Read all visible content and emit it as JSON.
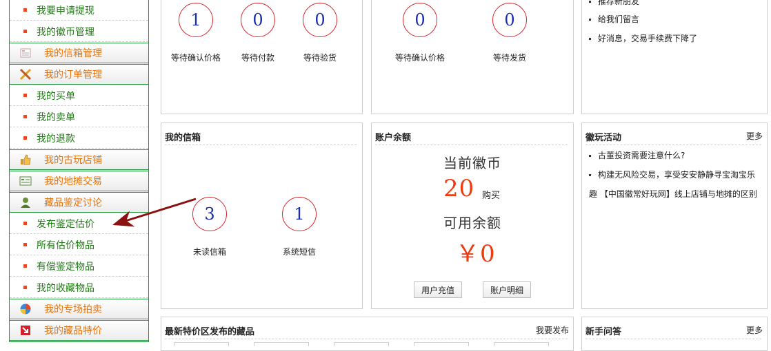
{
  "sidebar": {
    "items": [
      {
        "type": "item",
        "label": "我要申请提现"
      },
      {
        "type": "item",
        "label": "我的徽币管理"
      },
      {
        "type": "header",
        "label": "我的信箱管理",
        "icon": "mailbox-icon"
      },
      {
        "type": "header",
        "label": "我的订单管理",
        "icon": "pencil-ruler-icon"
      },
      {
        "type": "item",
        "label": "我的买单"
      },
      {
        "type": "item",
        "label": "我的卖单"
      },
      {
        "type": "item",
        "label": "我的退款"
      },
      {
        "type": "header",
        "label": "我的古玩店铺",
        "icon": "thumbs-up-icon"
      },
      {
        "type": "header",
        "label": "我的地摊交易",
        "icon": "list-card-icon"
      },
      {
        "type": "header",
        "label": "藏品鉴定讨论",
        "icon": "user-icon"
      },
      {
        "type": "item",
        "label": "发布鉴定估价"
      },
      {
        "type": "item",
        "label": "所有估价物品"
      },
      {
        "type": "item",
        "label": "有偿鉴定物品"
      },
      {
        "type": "item",
        "label": "我的收藏物品"
      },
      {
        "type": "header",
        "label": "我的专场拍卖",
        "icon": "globe-icon"
      },
      {
        "type": "header",
        "label": "我的藏品特价",
        "icon": "red-arrow-icon"
      }
    ]
  },
  "buy_panel": {
    "stats": [
      {
        "value": "1",
        "label": "等待确认价格"
      },
      {
        "value": "0",
        "label": "等待付款"
      },
      {
        "value": "0",
        "label": "等待验货"
      }
    ]
  },
  "sell_panel": {
    "stats": [
      {
        "value": "0",
        "label": "等待确认价格"
      },
      {
        "value": "0",
        "label": "等待发货"
      }
    ]
  },
  "notice_panel": {
    "partial_item": "推荐新朋友",
    "items": [
      "给我们留言",
      "好消息，交易手续费下降了"
    ]
  },
  "mailbox_panel": {
    "title": "我的信箱",
    "stats": [
      {
        "value": "3",
        "label": "未读信箱"
      },
      {
        "value": "1",
        "label": "系统短信"
      }
    ]
  },
  "balance_panel": {
    "title": "账户余额",
    "coin_label": "当前徽币",
    "coin_value": "20",
    "buy_link": "购买",
    "available_label": "可用余额",
    "available_value": "￥0",
    "recharge_button": "用户充值",
    "details_button": "账户明细"
  },
  "activity_panel": {
    "title": "徽玩活动",
    "more": "更多",
    "item1": "古董投资需要注意什么?",
    "item2_line1": "构建无风险交易，享受安安静静寻宝淘宝乐",
    "item2_line2": "趣 【中国徽常好玩网】线上店铺与地摊的区别"
  },
  "special_panel": {
    "title": "最新特价区发布的藏品",
    "action": "我要发布"
  },
  "faq_panel": {
    "title": "新手问答",
    "more": "更多"
  },
  "colors": {
    "sidebar_border": "#1f9a3c",
    "item_text": "#1f7a14",
    "header_text": "#e8730c",
    "bullet": "#e34a1f",
    "circle_border": "#d9262c",
    "circle_number": "#1a2fb0",
    "balance_value": "#ef3b12",
    "arrow": "#8b1010"
  }
}
